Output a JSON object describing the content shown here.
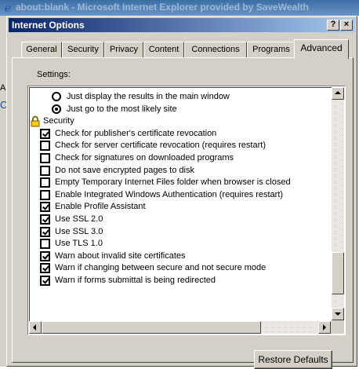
{
  "background_window": {
    "title": "about:blank - Microsoft Internet Explorer provided by SaveWealth",
    "side_letters": [
      "A",
      "C"
    ]
  },
  "dialog": {
    "title": "Internet Options",
    "help_label": "?",
    "close_label": "×",
    "tabs": [
      {
        "label": "General",
        "active": false
      },
      {
        "label": "Security",
        "active": false
      },
      {
        "label": "Privacy",
        "active": false
      },
      {
        "label": "Content",
        "active": false
      },
      {
        "label": "Connections",
        "active": false
      },
      {
        "label": "Programs",
        "active": false
      },
      {
        "label": "Advanced",
        "active": true
      }
    ],
    "settings_label": "Settings:",
    "items": [
      {
        "type": "radio",
        "checked": false,
        "label": "Just display the results in the main window"
      },
      {
        "type": "radio",
        "checked": true,
        "label": "Just go to the most likely site"
      },
      {
        "type": "group",
        "label": "Security",
        "icon": "lock-icon"
      },
      {
        "type": "checkbox",
        "checked": true,
        "label": "Check for publisher's certificate revocation"
      },
      {
        "type": "checkbox",
        "checked": false,
        "label": "Check for server certificate revocation (requires restart)"
      },
      {
        "type": "checkbox",
        "checked": false,
        "label": "Check for signatures on downloaded programs"
      },
      {
        "type": "checkbox",
        "checked": false,
        "label": "Do not save encrypted pages to disk"
      },
      {
        "type": "checkbox",
        "checked": false,
        "label": "Empty Temporary Internet Files folder when browser is closed"
      },
      {
        "type": "checkbox",
        "checked": false,
        "label": "Enable Integrated Windows Authentication (requires restart)"
      },
      {
        "type": "checkbox",
        "checked": true,
        "label": "Enable Profile Assistant"
      },
      {
        "type": "checkbox",
        "checked": true,
        "label": "Use SSL 2.0"
      },
      {
        "type": "checkbox",
        "checked": true,
        "label": "Use SSL 3.0"
      },
      {
        "type": "checkbox",
        "checked": false,
        "label": "Use TLS 1.0"
      },
      {
        "type": "checkbox",
        "checked": true,
        "label": "Warn about invalid site certificates"
      },
      {
        "type": "checkbox",
        "checked": true,
        "label": "Warn if changing between secure and not secure mode"
      },
      {
        "type": "checkbox",
        "checked": true,
        "label": "Warn if forms submittal is being redirected"
      }
    ],
    "vertical_scroll_position": 0.92,
    "restore_defaults_label": "Restore Defaults"
  }
}
